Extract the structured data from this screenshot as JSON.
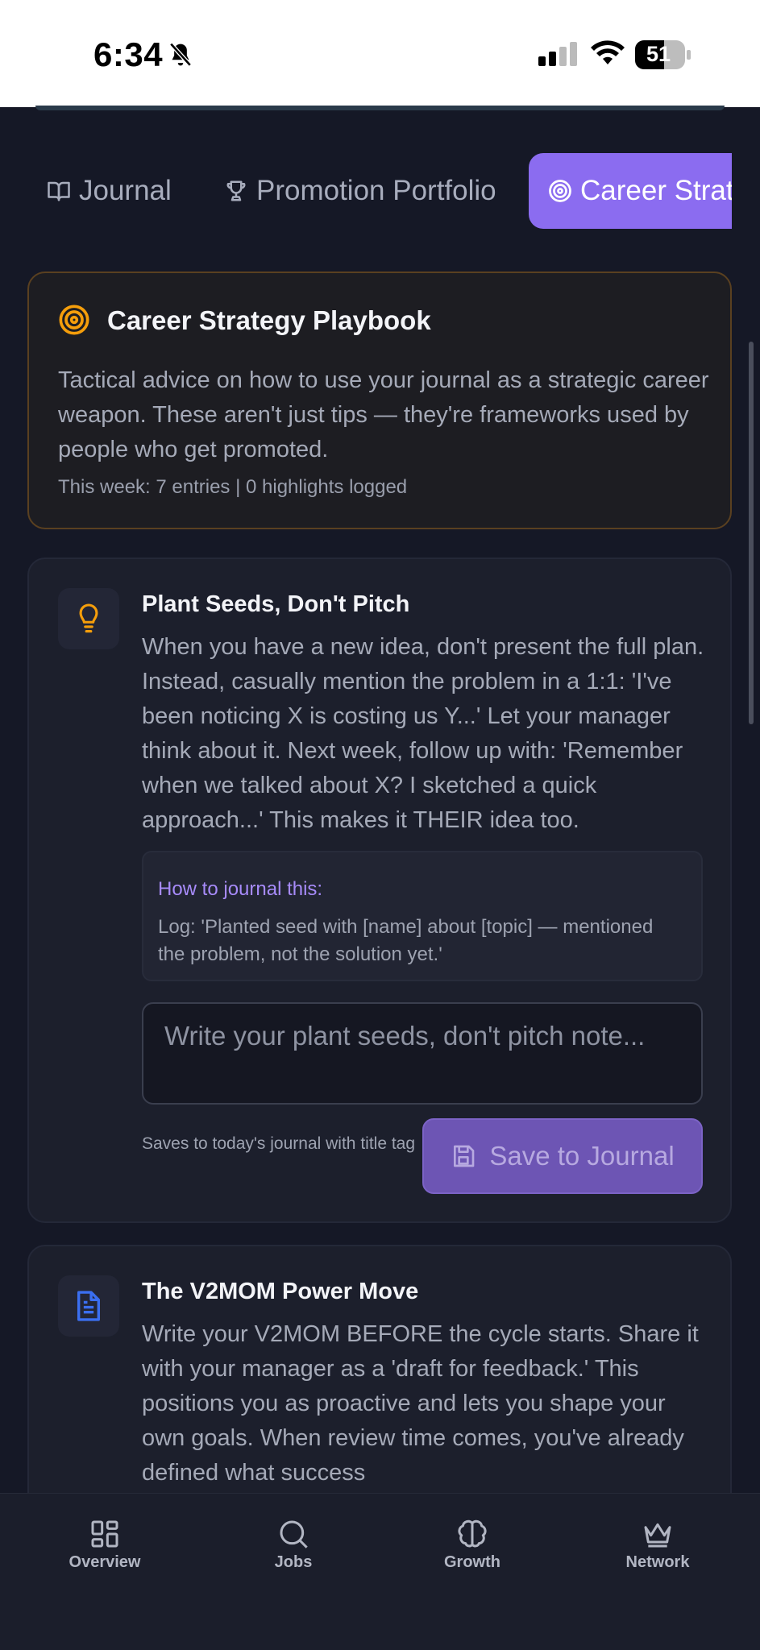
{
  "status_bar": {
    "time": "6:34",
    "battery": "51"
  },
  "tabs": [
    {
      "label": "Journal",
      "icon": "book-open-icon"
    },
    {
      "label": "Promotion Portfolio",
      "icon": "trophy-icon"
    },
    {
      "label": "Career Strat",
      "icon": "target-icon",
      "active": true
    }
  ],
  "hero": {
    "title": "Career Strategy Playbook",
    "description": "Tactical advice on how to use your journal as a strategic career weapon. These aren't just tips — they're frameworks used by people who get promoted.",
    "stats": "This week: 7 entries | 0 highlights logged"
  },
  "tips": [
    {
      "icon": "lightbulb-icon",
      "title": "Plant Seeds, Don't Pitch",
      "body": "When you have a new idea, don't present the full plan. Instead, casually mention the problem in a 1:1: 'I've been noticing X is costing us Y...' Let your manager think about it. Next week, follow up with: 'Remember when we talked about X? I sketched a quick approach...' This makes it THEIR idea too.",
      "howto_label": "How to journal this:",
      "howto_text": "Log: 'Planted seed with [name] about [topic] — mentioned the problem, not the solution yet.'",
      "input_placeholder": "Write your plant seeds, don't pitch note...",
      "save_hint": "Saves to today's journal with title tag",
      "save_label": "Save to Journal"
    },
    {
      "icon": "document-icon",
      "title": "The V2MOM Power Move",
      "body": "Write your V2MOM BEFORE the cycle starts. Share it with your manager as a 'draft for feedback.' This positions you as proactive and lets you shape your own goals. When review time comes, you've already defined what success"
    }
  ],
  "bottom_nav": [
    {
      "label": "Overview",
      "icon": "grid-icon"
    },
    {
      "label": "Jobs",
      "icon": "search-icon"
    },
    {
      "label": "Growth",
      "icon": "brain-icon"
    },
    {
      "label": "Network",
      "icon": "crown-icon"
    }
  ],
  "colors": {
    "accent": "#8b6cf0",
    "hero_icon": "#f59e0b",
    "tip_icon_1": "#f59e0b",
    "tip_icon_2": "#3b6ff0"
  }
}
